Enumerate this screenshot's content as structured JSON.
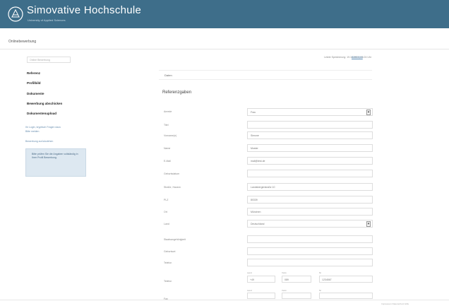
{
  "header": {
    "brand": "Simovative Hochschule",
    "tagline": "University of Applied Sciences"
  },
  "topbar": {
    "title": "Onlinebewerbung"
  },
  "sidebar": {
    "placeholder": "Online Bewerbung",
    "steps": [
      {
        "label": "Referenz"
      },
      {
        "label": "Profilbild"
      },
      {
        "label": "Dokumente"
      },
      {
        "label": "Bewerbung abschicken"
      },
      {
        "label": "Dokumentenupload"
      }
    ],
    "links": [
      "Ihr Login, kryptisch Fragen dazu",
      "Bitte melden",
      "Bewerbung zurückziehen"
    ],
    "infobox": "Bitte prüfen Sie die Angaben vollständig in Ihrer Profil Bewerbung."
  },
  "status": {
    "text": "Letzte Speicherung: 19.10.2014, 16:24 Uhr",
    "link": "Abmelden"
  },
  "main": {
    "crumb": "Daten",
    "section_title": "Referenzgaben",
    "fields": [
      {
        "label": "Anrede",
        "value": "Frau",
        "select": true
      },
      {
        "label": "Titel",
        "value": ""
      },
      {
        "label": "Vorname(n)",
        "value": "Simone"
      },
      {
        "label": "Name",
        "value": "Muster"
      },
      {
        "label": "E-Mail",
        "value": "mail@test.de"
      },
      {
        "label": "Geburtsdatum",
        "value": ""
      },
      {
        "label": "Straße, Hausnr.",
        "value": "Landsbergerstraße 10"
      },
      {
        "label": "PLZ",
        "value": "80339"
      },
      {
        "label": "Ort",
        "value": "München"
      },
      {
        "label": "Land",
        "value": "Deutschland",
        "select": true
      },
      {
        "label": "Staatsangehörigkeit",
        "value": ""
      },
      {
        "label": "Geburtsort",
        "value": ""
      },
      {
        "label": "Telefon",
        "value": ""
      }
    ],
    "phone_row": {
      "label": "Telefon",
      "country_label": "Land",
      "country": "+49",
      "area_label": "Vorw",
      "area": "089",
      "number_label": "Nr",
      "number": "1234567"
    },
    "fax_row": {
      "label": "Fax",
      "country_label": "Land",
      "area_label": "Vorw",
      "number_label": "Nr"
    }
  },
  "footer": {
    "links": "Impressum  Datenschutz  Hilfe"
  }
}
